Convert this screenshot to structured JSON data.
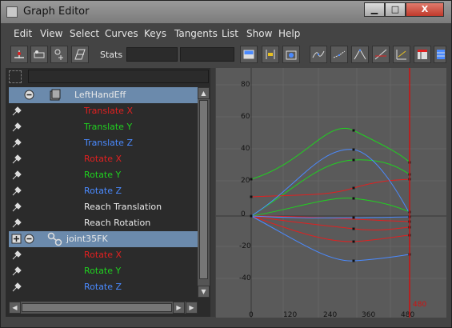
{
  "window": {
    "title": "Graph Editor",
    "close_label": "X"
  },
  "menubar": [
    "Edit",
    "View",
    "Select",
    "Curves",
    "Keys",
    "Tangents",
    "List",
    "Show",
    "Help"
  ],
  "toolbar": {
    "stats_label": "Stats"
  },
  "outliner": {
    "rows": [
      {
        "label": "LeftHandEff",
        "color": "#e8e8e8",
        "kind": "node",
        "selected": true
      },
      {
        "label": "Translate X",
        "color": "#e02020",
        "kind": "channel"
      },
      {
        "label": "Translate Y",
        "color": "#20d020",
        "kind": "channel"
      },
      {
        "label": "Translate Z",
        "color": "#4a8aff",
        "kind": "channel"
      },
      {
        "label": "Rotate X",
        "color": "#e02020",
        "kind": "channel"
      },
      {
        "label": "Rotate Y",
        "color": "#20d020",
        "kind": "channel"
      },
      {
        "label": "Rotate Z",
        "color": "#4a8aff",
        "kind": "channel"
      },
      {
        "label": "Reach Translation",
        "color": "#e8e8e8",
        "kind": "channel"
      },
      {
        "label": "Reach Rotation",
        "color": "#e8e8e8",
        "kind": "channel"
      },
      {
        "label": "joint35FK",
        "color": "#e8e8e8",
        "kind": "node",
        "selected": true
      },
      {
        "label": "Rotate X",
        "color": "#e02020",
        "kind": "channel"
      },
      {
        "label": "Rotate Y",
        "color": "#20d020",
        "kind": "channel"
      },
      {
        "label": "Rotate Z",
        "color": "#4a8aff",
        "kind": "channel"
      }
    ]
  },
  "graph": {
    "y_ticks": [
      "80",
      "60",
      "40",
      "20",
      "0",
      "-20",
      "-40"
    ],
    "x_ticks": [
      "0",
      "120",
      "240",
      "360",
      "480"
    ],
    "current_time": "480",
    "colors": {
      "red": "#e02020",
      "green": "#20d020",
      "blue": "#4a8aff",
      "key": "#111111",
      "time_marker": "#d01010"
    }
  }
}
